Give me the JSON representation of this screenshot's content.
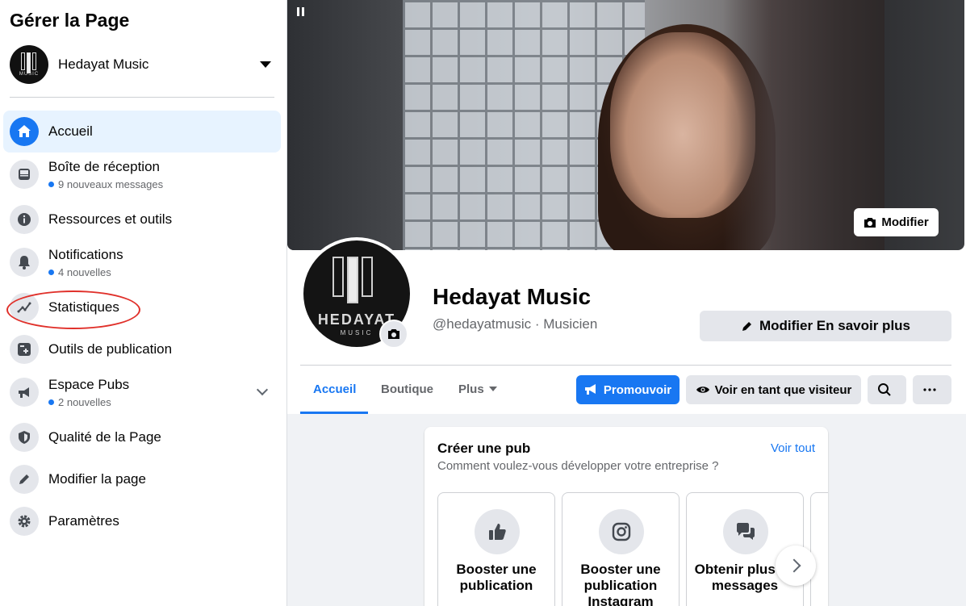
{
  "sidebar": {
    "title": "Gérer la Page",
    "page_name": "Hedayat Music",
    "items": [
      {
        "label": "Accueil",
        "sub": "",
        "icon": "home-icon"
      },
      {
        "label": "Boîte de réception",
        "sub": "9 nouveaux messages",
        "icon": "inbox-icon"
      },
      {
        "label": "Ressources et outils",
        "sub": "",
        "icon": "info-icon"
      },
      {
        "label": "Notifications",
        "sub": "4 nouvelles",
        "icon": "bell-icon"
      },
      {
        "label": "Statistiques",
        "sub": "",
        "icon": "chart-line-icon"
      },
      {
        "label": "Outils de publication",
        "sub": "",
        "icon": "publishing-tools-icon"
      },
      {
        "label": "Espace Pubs",
        "sub": "2 nouvelles",
        "icon": "megaphone-icon"
      },
      {
        "label": "Qualité de la Page",
        "sub": "",
        "icon": "shield-icon"
      },
      {
        "label": "Modifier la page",
        "sub": "",
        "icon": "pencil-icon"
      },
      {
        "label": "Paramètres",
        "sub": "",
        "icon": "gear-icon"
      }
    ]
  },
  "cover": {
    "edit_label": "Modifier"
  },
  "profile": {
    "logo_text": "HEDAYAT",
    "logo_sub": "MUSIC",
    "name": "Hedayat Music",
    "handle": "@hedayatmusic · Musicien",
    "edit_about_label": "Modifier En savoir plus"
  },
  "tabs": [
    {
      "label": "Accueil",
      "active": true
    },
    {
      "label": "Boutique",
      "active": false
    },
    {
      "label": "Plus",
      "active": false
    }
  ],
  "actions": {
    "promote_label": "Promouvoir",
    "view_as_label": "Voir en tant que visiteur"
  },
  "create_ad": {
    "title": "Créer une pub",
    "subtitle": "Comment voulez-vous développer votre entreprise ?",
    "see_all": "Voir tout",
    "options": [
      {
        "label": "Booster une publication",
        "icon": "thumbs-up-icon"
      },
      {
        "label": "Booster une publication Instagram",
        "icon": "instagram-icon"
      },
      {
        "label": "Obtenir plus de messages",
        "icon": "messenger-icon"
      }
    ]
  },
  "colors": {
    "accent": "#1877f2",
    "active_bg": "#e7f3ff",
    "annotation": "#e0302a"
  }
}
